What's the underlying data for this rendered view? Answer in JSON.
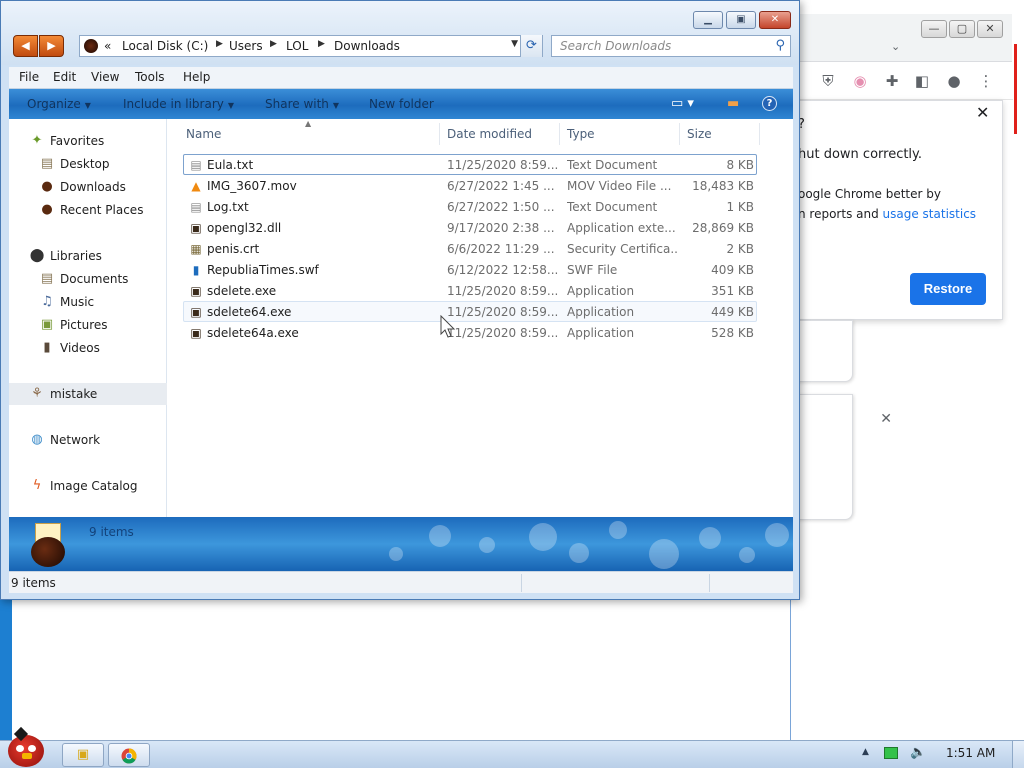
{
  "explorer": {
    "address": {
      "overflow": "«",
      "crumbs": [
        "Local Disk (C:)",
        "Users",
        "LOL",
        "Downloads"
      ]
    },
    "search_placeholder": "Search Downloads",
    "menu": [
      "File",
      "Edit",
      "View",
      "Tools",
      "Help"
    ],
    "commands": [
      "Organize",
      "Include in library",
      "Share with",
      "New folder"
    ],
    "help_symbol": "?",
    "nav": {
      "favorites_label": "Favorites",
      "favorites": [
        "Desktop",
        "Downloads",
        "Recent Places"
      ],
      "libraries_label": "Libraries",
      "libraries": [
        "Documents",
        "Music",
        "Pictures",
        "Videos"
      ],
      "homegroup": "mistake",
      "network": "Network",
      "catalog": "Image Catalog"
    },
    "columns": {
      "name": "Name",
      "date": "Date modified",
      "type": "Type",
      "size": "Size"
    },
    "files": [
      {
        "name": "Eula.txt",
        "date": "11/25/2020 8:59...",
        "type": "Text Document",
        "size": "8 KB",
        "icon": "text-file-icon"
      },
      {
        "name": "IMG_3607.mov",
        "date": "6/27/2022 1:45 ...",
        "type": "MOV Video File ...",
        "size": "18,483 KB",
        "icon": "vlc-cone-icon"
      },
      {
        "name": "Log.txt",
        "date": "6/27/2022 1:50 ...",
        "type": "Text Document",
        "size": "1 KB",
        "icon": "text-file-icon"
      },
      {
        "name": "opengl32.dll",
        "date": "9/17/2020 2:38 ...",
        "type": "Application exte...",
        "size": "28,869 KB",
        "icon": "dll-file-icon"
      },
      {
        "name": "penis.crt",
        "date": "6/6/2022 11:29 ...",
        "type": "Security Certifica...",
        "size": "2 KB",
        "icon": "certificate-icon"
      },
      {
        "name": "RepubliaTimes.swf",
        "date": "6/12/2022 12:58...",
        "type": "SWF File",
        "size": "409 KB",
        "icon": "swf-file-icon"
      },
      {
        "name": "sdelete.exe",
        "date": "11/25/2020 8:59...",
        "type": "Application",
        "size": "351 KB",
        "icon": "exe-file-icon"
      },
      {
        "name": "sdelete64.exe",
        "date": "11/25/2020 8:59...",
        "type": "Application",
        "size": "449 KB",
        "icon": "exe-file-icon"
      },
      {
        "name": "sdelete64a.exe",
        "date": "11/25/2020 8:59...",
        "type": "Application",
        "size": "528 KB",
        "icon": "exe-file-icon"
      }
    ],
    "details_count": "9 items",
    "status": "9 items"
  },
  "chrome": {
    "popup_question": "?",
    "popup_line1": "hut down correctly.",
    "popup_line2": "oogle Chrome better by",
    "popup_line3_prefix": "n reports and ",
    "popup_line3_link": "usage statistics",
    "restore_button": "Restore",
    "close_symbol": "✕"
  },
  "taskbar": {
    "clock": "1:51 AM"
  }
}
